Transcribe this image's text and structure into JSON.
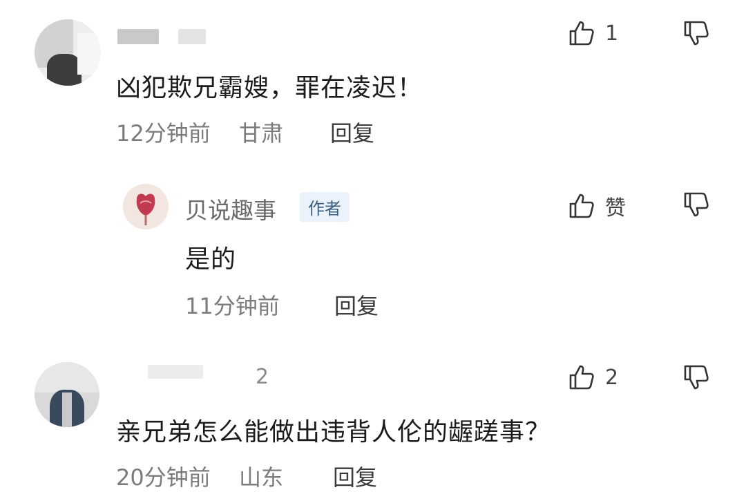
{
  "comments": [
    {
      "text": "凶犯欺兄霸嫂，罪在凌迟！",
      "time": "12分钟前",
      "location": "甘肃",
      "reply_label": "回复",
      "like_count": "1"
    },
    {
      "author": "贝说趣事",
      "badge": "作者",
      "text": "是的",
      "time": "11分钟前",
      "reply_label": "回复",
      "like_label": "赞"
    },
    {
      "name_fragment": "2",
      "text": "亲兄弟怎么能做出违背人伦的龌蹉事？",
      "time": "20分钟前",
      "location": "山东",
      "reply_label": "回复",
      "like_count": "2"
    }
  ]
}
